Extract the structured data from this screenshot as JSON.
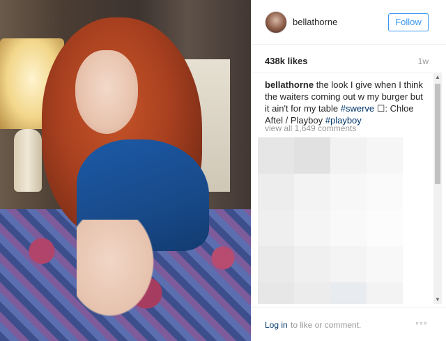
{
  "post": {
    "author": "bellathorne",
    "follow_label": "Follow",
    "likes": "438k likes",
    "time_ago": "1w",
    "caption": {
      "user": "bellathorne",
      "text_1": "the look I give when I think the waiters coming out w my burger but it ain't for my table",
      "hashtag_1": "#swerve",
      "text_2": "☐: Chloe Aftel / Playboy",
      "hashtag_2": "#playboy"
    },
    "view_all_comments": "view all 1,649 comments"
  },
  "footer": {
    "login_link": "Log in",
    "login_rest": "to like or comment.",
    "more": "◦◦◦"
  },
  "colors": {
    "link_blue": "#003569",
    "follow_blue": "#3897f0",
    "muted": "#999999",
    "text": "#262626"
  },
  "icons": {
    "more": "more-options-icon",
    "scroll_up": "scroll-up-arrow-icon",
    "scroll_down": "scroll-down-arrow-icon"
  },
  "scroll": {
    "up_glyph": "▲",
    "down_glyph": "▼"
  }
}
